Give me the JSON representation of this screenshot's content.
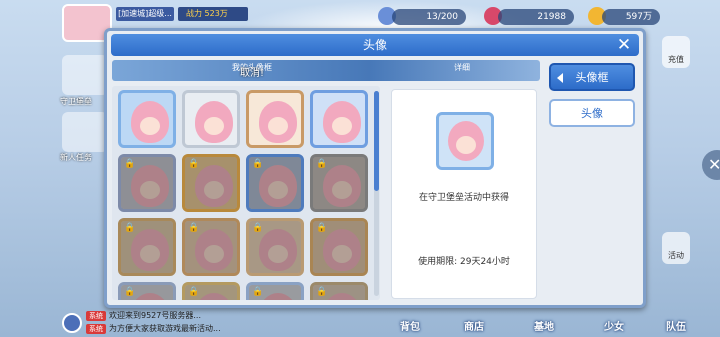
{
  "background": {
    "player_name": "[加速城]超级...",
    "power_label": "战力 523万",
    "resources": [
      {
        "value": "13/200",
        "icon": "stamina-icon",
        "color": "#6a8fd8"
      },
      {
        "value": "21988",
        "icon": "diamond-icon",
        "color": "#d8486a"
      },
      {
        "value": "597万",
        "icon": "gold-coin-icon",
        "color": "#f2b632"
      }
    ],
    "left_labels": [
      "守卫堡垒",
      "新人任务"
    ],
    "right_buttons": [
      "充值",
      "活动"
    ],
    "chat": [
      {
        "tag": "系统",
        "text": "欢迎来到9527号服务器..."
      },
      {
        "tag": "系统",
        "text": "为方便大家获取游戏最新活动..."
      }
    ],
    "bottom_nav": [
      "背包",
      "商店",
      "基地",
      "少女",
      "队伍"
    ]
  },
  "dialog": {
    "title": "头像",
    "tabs": [
      {
        "label": "我的头像框"
      },
      {
        "label": "详细"
      }
    ],
    "toast": "取消!",
    "detail": {
      "source": "在守卫堡垒活动中获得",
      "expiry": "使用期限: 29天24小时"
    },
    "side_buttons": [
      {
        "label": "头像框",
        "active": true
      },
      {
        "label": "头像",
        "active": false
      }
    ],
    "frames": [
      {
        "locked": false,
        "color": "#bcd8f5",
        "border": "#7fb0e6"
      },
      {
        "locked": false,
        "color": "#e9edf2",
        "border": "#bfc8d4"
      },
      {
        "locked": false,
        "color": "#f7e8d8",
        "border": "#c99a66"
      },
      {
        "locked": false,
        "color": "#cfe0f7",
        "border": "#6f9ee0"
      },
      {
        "locked": true,
        "color": "#b9c3d6",
        "border": "#7d8aa8"
      },
      {
        "locked": true,
        "color": "#e6c68a",
        "border": "#b8893c"
      },
      {
        "locked": true,
        "color": "#9db7d9",
        "border": "#4e7bbd"
      },
      {
        "locked": true,
        "color": "#b7b7b7",
        "border": "#7a7a7a"
      },
      {
        "locked": true,
        "color": "#d8c7a6",
        "border": "#a8895a"
      },
      {
        "locked": true,
        "color": "#e0c9a9",
        "border": "#b0895a"
      },
      {
        "locked": true,
        "color": "#e8d3b8",
        "border": "#b99a72"
      },
      {
        "locked": true,
        "color": "#d9c2a0",
        "border": "#a98553"
      },
      {
        "locked": true,
        "color": "#c8d3e2",
        "border": "#8a9bb8"
      },
      {
        "locked": true,
        "color": "#e0cfa8",
        "border": "#b49a60"
      },
      {
        "locked": true,
        "color": "#cdd9e8",
        "border": "#8aa2c4"
      },
      {
        "locked": true,
        "color": "#d4c9b6",
        "border": "#9c8a6a"
      }
    ]
  }
}
